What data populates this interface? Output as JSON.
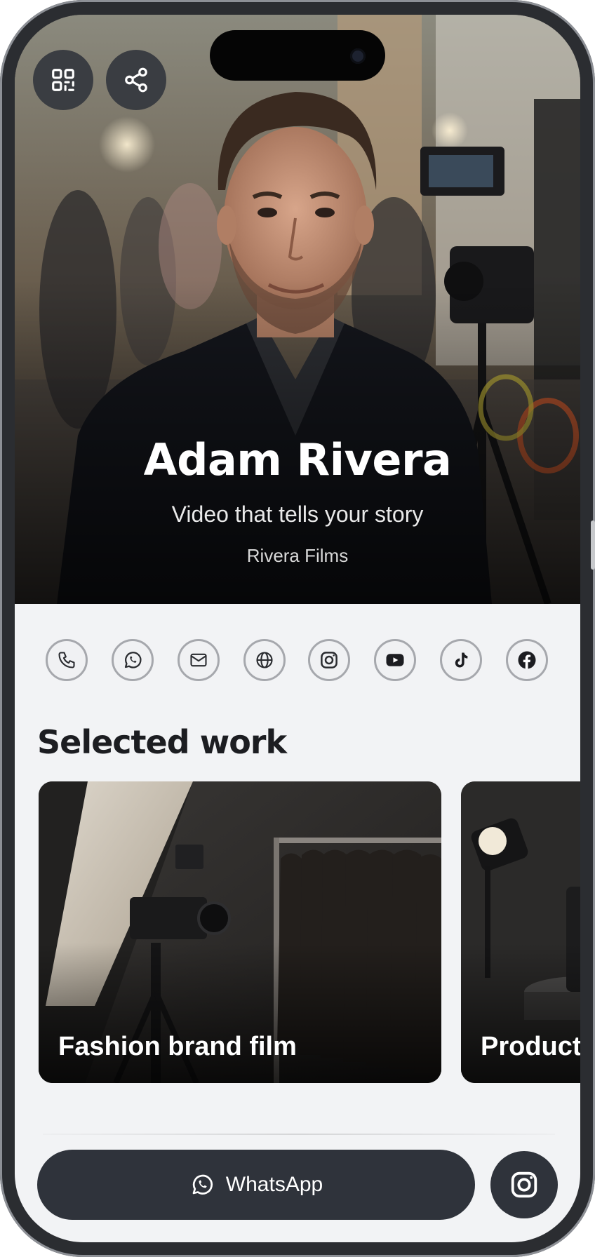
{
  "profile": {
    "name": "Adam Rivera",
    "tagline": "Video that tells your story",
    "company": "Rivera Films"
  },
  "top_actions": [
    {
      "icon": "qr-code-icon"
    },
    {
      "icon": "share-icon"
    }
  ],
  "contact_links": [
    {
      "icon": "phone-icon"
    },
    {
      "icon": "whatsapp-icon"
    },
    {
      "icon": "mail-icon"
    },
    {
      "icon": "globe-icon"
    },
    {
      "icon": "instagram-icon"
    },
    {
      "icon": "youtube-icon"
    },
    {
      "icon": "tiktok-icon"
    },
    {
      "icon": "facebook-icon"
    }
  ],
  "work": {
    "title": "Selected work",
    "items": [
      {
        "label": "Fashion brand film"
      },
      {
        "label": "Product"
      }
    ]
  },
  "bottom_bar": {
    "whatsapp_label": "WhatsApp",
    "instagram_icon": "instagram-icon"
  },
  "colors": {
    "dark_button": "#2f333b",
    "background": "#f2f3f5",
    "title_text": "#1c1d21"
  }
}
